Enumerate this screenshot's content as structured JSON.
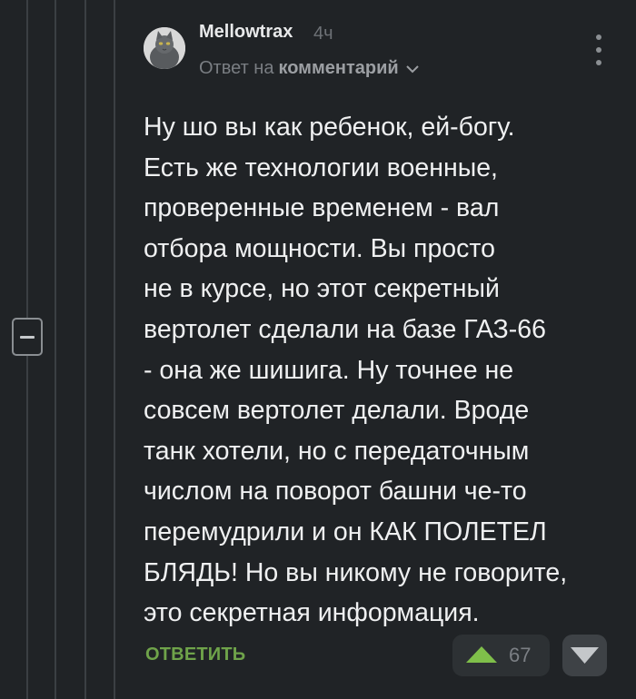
{
  "comment": {
    "author": "Mellowtrax",
    "time_ago": "4ч",
    "reply_prefix": "Ответ на",
    "reply_target": "комментарий",
    "body_lines": [
      "Ну шо вы как ребенок, ей-богу.",
      "Есть же технологии военные,",
      "проверенные временем - вал",
      "отбора мощности. Вы просто",
      "не в курсе, но этот секретный",
      "вертолет сделали на базе ГАЗ-66",
      "- она же шишига. Ну точнее не",
      "совсем вертолет делали. Вроде",
      "танк хотели, но с передаточным",
      "числом на поворот башни че-то",
      "перемудрили и он КАК ПОЛЕТЕЛ",
      "БЛЯДЬ! Но вы никому не говорите,",
      "это секретная информация."
    ]
  },
  "actions": {
    "reply_label": "ОТВЕТИТЬ",
    "rating": "67"
  },
  "colors": {
    "background": "#202326",
    "text": "#eff0f1",
    "reply_green": "#6fa34a",
    "upvote_green": "#7fbf4a",
    "thread_line": "#3b3f43"
  },
  "icons": {
    "collapse": "minus-square-icon",
    "menu": "more-vertical-icon",
    "chevron": "chevron-down-icon",
    "upvote": "triangle-up-icon",
    "downvote": "triangle-down-icon"
  }
}
